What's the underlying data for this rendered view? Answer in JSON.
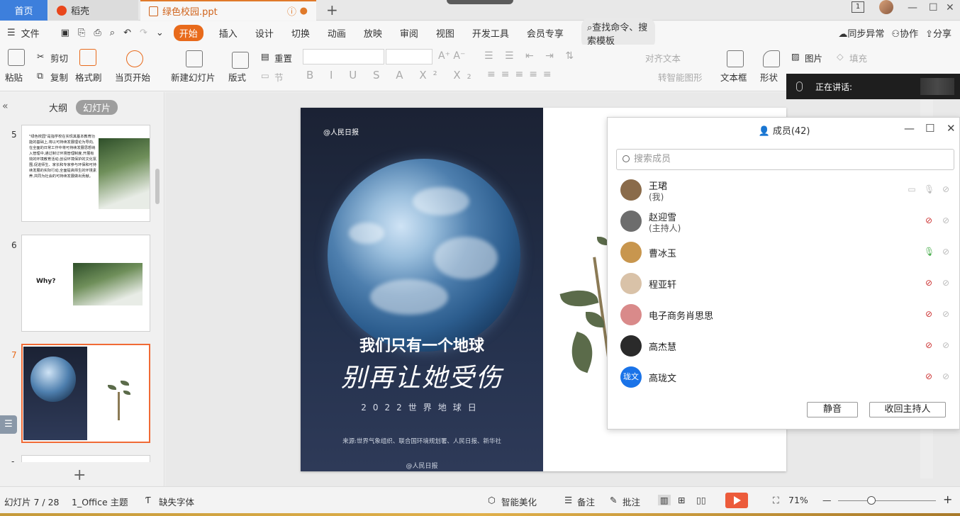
{
  "tabs": {
    "home": "首页",
    "daoke": "稻壳",
    "file": "绿色校园.ppt"
  },
  "menubar": {
    "file": "文件",
    "items": [
      "开始",
      "插入",
      "设计",
      "切换",
      "动画",
      "放映",
      "审阅",
      "视图",
      "开发工具",
      "会员专享"
    ],
    "search": "查找命令、搜索模板",
    "sync": "同步异常",
    "collab": "协作",
    "share": "分享"
  },
  "ribbon": {
    "paste": "粘贴",
    "cut": "剪切",
    "copy": "复制",
    "format_painter": "格式刷",
    "play_from_current": "当页开始",
    "new_slide": "新建幻灯片",
    "layout": "版式",
    "reset": "重置",
    "section": "节",
    "align_text": "对齐文本",
    "smart_graphic": "转智能图形",
    "textbox": "文本框",
    "shape": "形状",
    "picture": "图片",
    "fill": "填充"
  },
  "meeting": {
    "speaking": "正在讲话:"
  },
  "left_panel": {
    "tab_outline": "大纲",
    "tab_slides": "幻灯片",
    "slides": [
      {
        "num": "5",
        "text": "\"绿色校园\"是指学校在实现其基本教育功能的基础上,将以可持续发展理论为导向,在全面的日常工作中将可持续发展思想纳入管理中,通过制订环境管理制度,开展有效的环境教育活动,创设环境保护的文化氛围,促进师生、家长和专家参与环保和可持续发展的实际行动,全面提高师生的环境素养,共同为社会的可持续发展做出贡献。"
      },
      {
        "num": "6",
        "text": "Why?"
      },
      {
        "num": "7",
        "text": ""
      },
      {
        "num": "-",
        "text": ""
      }
    ]
  },
  "slide": {
    "logo": "@人民日报",
    "title_1": "我们只有一个地球",
    "title_2": "别再让她受伤",
    "subtitle": "2022世界地球日",
    "source": "来源:世界气象组织、联合国环境规划署、人民日报、新华社",
    "weibo": "@人民日报"
  },
  "members_dialog": {
    "title": "成员(42)",
    "search_placeholder": "搜索成员",
    "members": [
      {
        "name": "王珺",
        "role": "(我)",
        "avatar_color": "#8a6b4a"
      },
      {
        "name": "赵迎雪",
        "role": "(主持人)",
        "avatar_color": "#6d6d6d"
      },
      {
        "name": "曹冰玉",
        "role": "",
        "avatar_color": "#c8964e"
      },
      {
        "name": "程亚轩",
        "role": "",
        "avatar_color": "#d9c2a8"
      },
      {
        "name": "电子商务肖思思",
        "role": "",
        "avatar_color": "#d98a8a"
      },
      {
        "name": "高杰慧",
        "role": "",
        "avatar_color": "#2a2a2a"
      },
      {
        "name": "高珑文",
        "role": "",
        "avatar_color": "#1a73e8",
        "avatar_text": "珑文"
      }
    ],
    "mute_all": "静音",
    "reclaim_host": "收回主持人"
  },
  "statusbar": {
    "slide_pos": "幻灯片 7 / 28",
    "theme": "1_Office 主题",
    "missing_font": "缺失字体",
    "beautify": "智能美化",
    "notes": "备注",
    "comments": "批注",
    "zoom": "71%"
  }
}
